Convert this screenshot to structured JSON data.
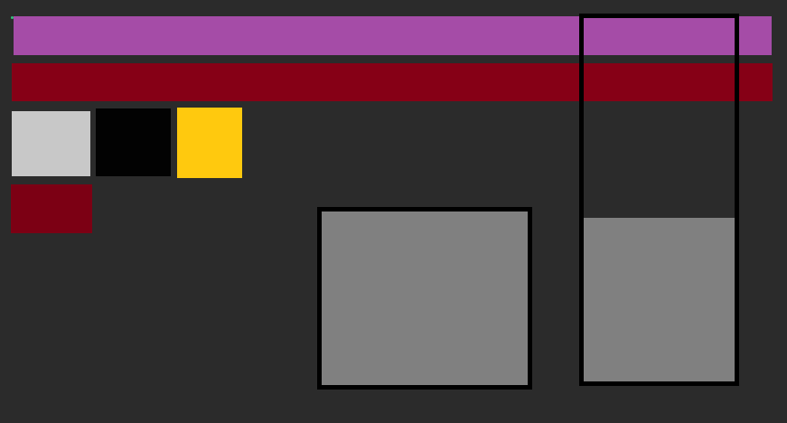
{
  "colors": {
    "background": "#2b2b2b",
    "indicator_dot": "#35c07a",
    "bar_top": "#a54ca7",
    "bar_mid": "#860016",
    "swatch_light_gray": "#c8c8c8",
    "swatch_black": "#020202",
    "swatch_yellow": "#ffc90e",
    "swatch_crimson": "#7c0014",
    "panel_gray": "#808080",
    "panel_border": "#000000"
  },
  "right_panel": {
    "fill_fraction": 0.45
  }
}
